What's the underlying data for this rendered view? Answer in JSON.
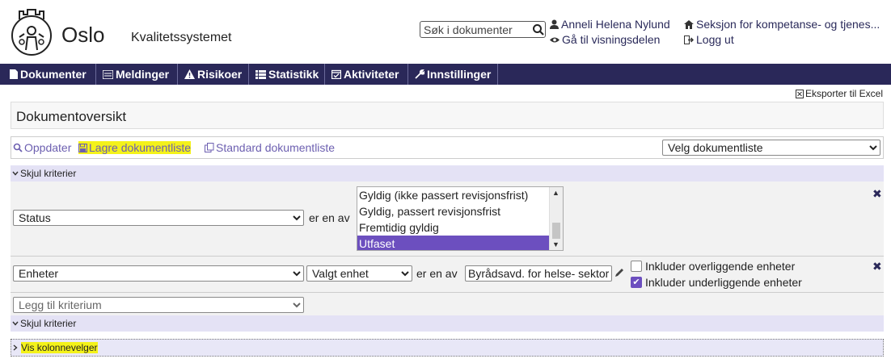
{
  "header": {
    "app_name": "Oslo",
    "app_subtitle": "Kvalitetssystemet",
    "search_placeholder": "Søk i dokumenter",
    "user_name": "Anneli Helena Nylund",
    "department": "Seksjon for kompetanse- og tjenes...",
    "view_link": "Gå til visningsdelen",
    "logout": "Logg ut"
  },
  "nav": {
    "items": [
      {
        "label": "Dokumenter",
        "icon": "document-icon"
      },
      {
        "label": "Meldinger",
        "icon": "list-icon"
      },
      {
        "label": "Risikoer",
        "icon": "warning-icon"
      },
      {
        "label": "Statistikk",
        "icon": "table-icon"
      },
      {
        "label": "Aktiviteter",
        "icon": "calendar-check-icon"
      },
      {
        "label": "Innstillinger",
        "icon": "wrench-icon"
      }
    ],
    "background_color": "#2a2859"
  },
  "export_label": "Eksporter til Excel",
  "page_title": "Dokumentoversikt",
  "toolbar": {
    "refresh": "Oppdater",
    "save_list": "Lagre dokumentliste",
    "standard_list": "Standard dokumentliste",
    "list_select": "Velg dokumentliste"
  },
  "criteria": {
    "hide_label": "Skjul kriterier",
    "row1": {
      "field": "Status",
      "operator": "er en av",
      "options": [
        "Gyldig (ikke passert revisjonsfrist)",
        "Gyldig, passert revisjonsfrist",
        "Fremtidig gyldig",
        "Utfaset"
      ],
      "selected": "Utfaset"
    },
    "row2": {
      "field": "Enheter",
      "subfield": "Valgt enhet",
      "operator": "er en av",
      "value": "Byrådsavd. for helse- sektor",
      "include_parent": "Inkluder overliggende enheter",
      "include_parent_checked": false,
      "include_children": "Inkluder underliggende enheter",
      "include_children_checked": true
    },
    "add_placeholder": "Legg til kriterium",
    "hide_label_bottom": "Skjul kriterier"
  },
  "column_selector": "Vis kolonnevelger",
  "accent_color": "#6c4fbf",
  "highlight_color": "#f4f21a"
}
